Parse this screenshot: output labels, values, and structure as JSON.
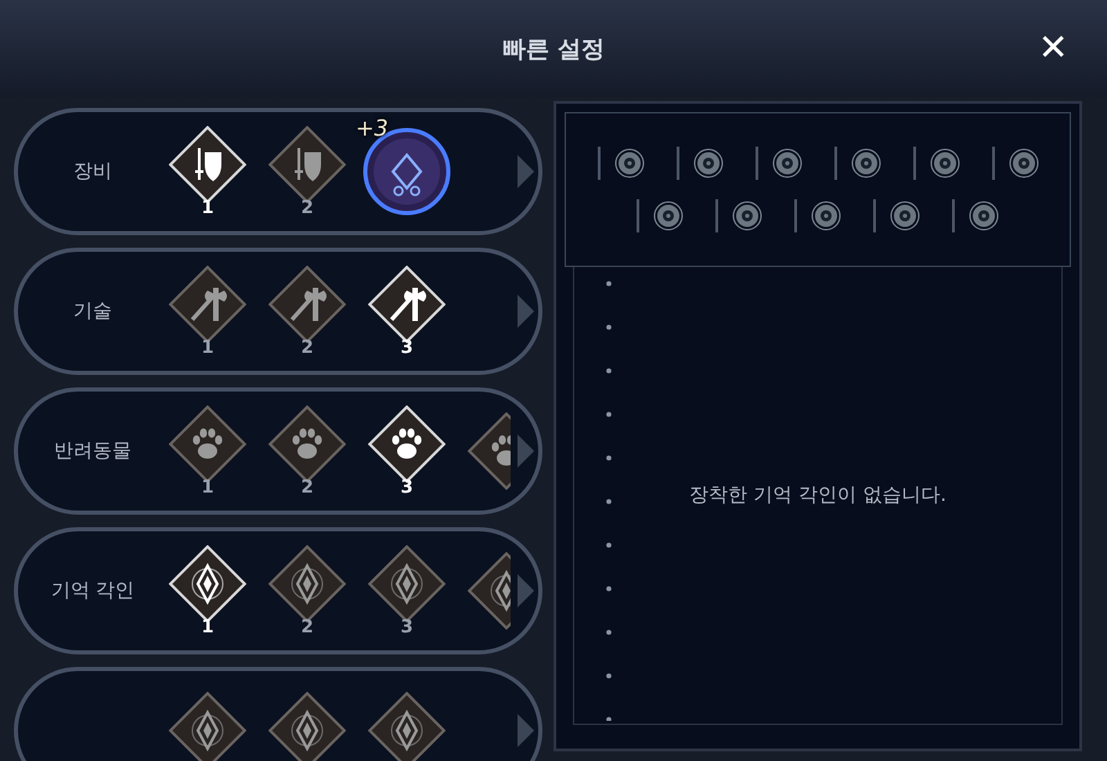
{
  "window": {
    "title": "빠른 설정",
    "close": "✕"
  },
  "rows": [
    {
      "kind": "equipment",
      "label": "장비",
      "slots": [
        {
          "kind": "icon",
          "number": "1",
          "selected": true
        },
        {
          "kind": "icon",
          "number": "2",
          "selected": false
        },
        {
          "kind": "orb",
          "badge": "+3",
          "selected": false
        }
      ]
    },
    {
      "kind": "skill",
      "label": "기술",
      "slots": [
        {
          "kind": "icon",
          "number": "1",
          "selected": false
        },
        {
          "kind": "icon",
          "number": "2",
          "selected": false
        },
        {
          "kind": "icon",
          "number": "3",
          "selected": true
        }
      ]
    },
    {
      "kind": "pet",
      "label": "반려동물",
      "slots": [
        {
          "kind": "icon",
          "number": "1",
          "selected": false
        },
        {
          "kind": "icon",
          "number": "2",
          "selected": false
        },
        {
          "kind": "icon",
          "number": "3",
          "selected": true
        },
        {
          "kind": "icon",
          "selected": false
        }
      ]
    },
    {
      "kind": "memory",
      "label": "기억 각인",
      "slots": [
        {
          "kind": "icon",
          "number": "1",
          "selected": true
        },
        {
          "kind": "icon",
          "number": "2",
          "selected": false
        },
        {
          "kind": "icon",
          "number": "3",
          "selected": false
        },
        {
          "kind": "icon",
          "selected": false
        }
      ]
    },
    {
      "kind": "memory",
      "slots": [
        {
          "kind": "icon",
          "selected": false
        },
        {
          "kind": "icon",
          "selected": false
        },
        {
          "kind": "icon",
          "selected": false
        }
      ]
    }
  ],
  "panel": {
    "socket_rows": [
      {
        "sockets": [
          {
            "kind": "empty"
          },
          {
            "kind": "empty"
          },
          {
            "kind": "empty"
          },
          {
            "kind": "empty"
          },
          {
            "kind": "empty"
          },
          {
            "kind": "empty"
          }
        ]
      },
      {
        "sockets": [
          {
            "kind": "empty"
          },
          {
            "kind": "empty"
          },
          {
            "kind": "empty"
          },
          {
            "kind": "empty"
          },
          {
            "kind": "empty"
          }
        ]
      }
    ],
    "empty_message": "장착한 기억 각인이 없습니다."
  }
}
